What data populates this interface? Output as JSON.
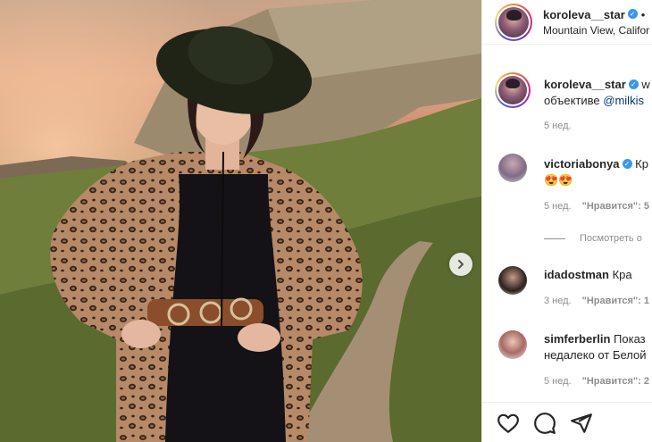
{
  "post": {
    "author": "koroleva__star",
    "location": "Mountain View, Califor",
    "separator": "•"
  },
  "caption": {
    "author": "koroleva__star",
    "text_line1": "w",
    "text_line2_prefix": "объективе ",
    "mention": "@milkis",
    "time": "5 нед."
  },
  "comments": [
    {
      "author": "victoriabonya",
      "verified": true,
      "text_line1": "Кр",
      "text_line2": "😍😍",
      "time": "5 нед.",
      "likes": "\"Нравится\": 5",
      "view_replies": "Посмотреть о"
    },
    {
      "author": "idadostman",
      "verified": false,
      "text_line1": "Кра",
      "time": "3 нед.",
      "likes": "\"Нравится\": 1"
    },
    {
      "author": "simferberlin",
      "verified": false,
      "text_line1": "Показ",
      "text_line2": "недалеко от Белой",
      "time": "5 нед.",
      "likes": "\"Нравится\": 2"
    }
  ],
  "icons": {
    "verified": "✓",
    "like": "heart-icon",
    "comment": "comment-icon",
    "share": "share-icon",
    "next": "chevron-right-icon"
  },
  "colors": {
    "link": "#00376b",
    "verified_badge": "#3897f0",
    "muted_text": "#8e8e8e",
    "divider": "#efefef"
  }
}
